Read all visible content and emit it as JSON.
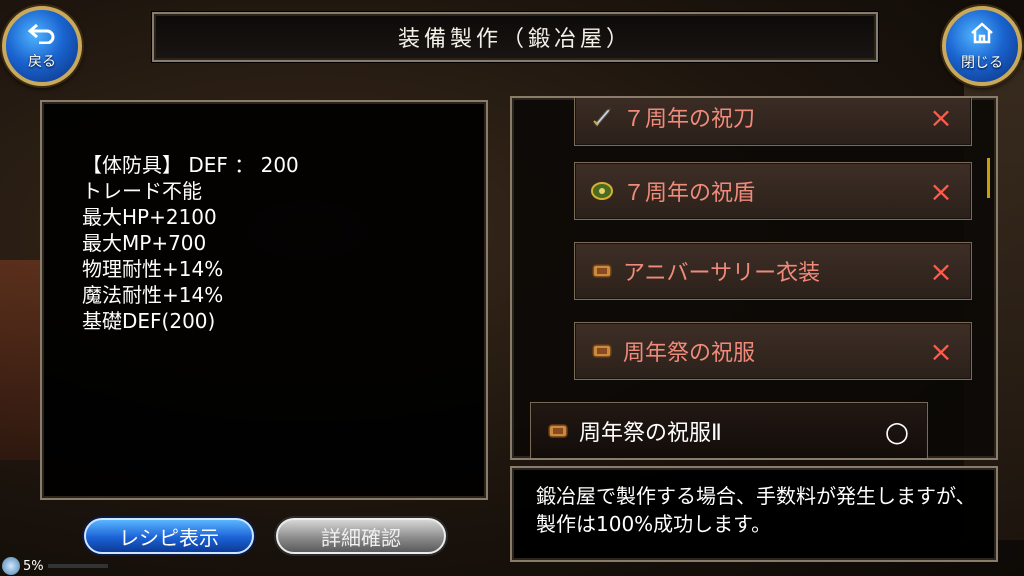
{
  "header": {
    "title": "装備製作（鍛冶屋）"
  },
  "nav": {
    "back": {
      "label": "戻る",
      "icon": "back-arrow-icon"
    },
    "close": {
      "label": "閉じる",
      "icon": "home-icon"
    }
  },
  "stats": {
    "lines": [
      "【体防具】 DEF ： 200",
      "トレード不能",
      "最大HP+2100",
      "最大MP+700",
      "物理耐性+14%",
      "魔法耐性+14%",
      "基礎DEF(200)"
    ]
  },
  "recipe_list": {
    "items": [
      {
        "name": "７周年の祝刀",
        "icon": "sword-icon",
        "status": "×",
        "craftable": false
      },
      {
        "name": "７周年の祝盾",
        "icon": "shield-icon",
        "status": "×",
        "craftable": false
      },
      {
        "name": "アニバーサリー衣装",
        "icon": "armor-icon",
        "status": "×",
        "craftable": false
      },
      {
        "name": "周年祭の祝服",
        "icon": "armor-icon",
        "status": "×",
        "craftable": false
      },
      {
        "name": "周年祭の祝服Ⅱ",
        "icon": "armor-icon",
        "status": "○",
        "craftable": true
      }
    ]
  },
  "info": {
    "text": "鍛冶屋で製作する場合、手数料が発生しますが、製作は100%成功します。"
  },
  "buttons": {
    "recipe": "レシピ表示",
    "detail": "詳細確認"
  },
  "status": {
    "percent_text": "5%",
    "progress": 0.05
  },
  "colors": {
    "accent_blue": "#1b62d6",
    "unavailable_red": "#f08a7a",
    "cross_red": "#ff5a4a"
  }
}
